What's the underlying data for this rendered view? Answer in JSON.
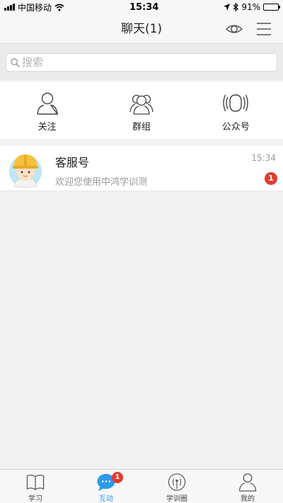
{
  "status_bar": {
    "carrier": "中国移动",
    "time": "15:34",
    "battery": "91%",
    "battery_level": 0.91
  },
  "header": {
    "title": "聊天(1)",
    "eye_icon": "eye-icon",
    "menu_icon": "menu-icon"
  },
  "search": {
    "placeholder": "搜索",
    "value": ""
  },
  "quick_actions": [
    {
      "label": "关注",
      "icon": "person-icon"
    },
    {
      "label": "群组",
      "icon": "group-icon"
    },
    {
      "label": "公众号",
      "icon": "broadcast-icon"
    }
  ],
  "chats": [
    {
      "name": "客服号",
      "message": "欢迎您使用中鸿学训测",
      "time": "15:34",
      "unread": "1",
      "avatar": "worker-helmet-avatar"
    }
  ],
  "tabs": [
    {
      "label": "学习",
      "icon": "book-icon",
      "active": false
    },
    {
      "label": "互动",
      "icon": "chat-bubble-icon",
      "active": true,
      "badge": "1"
    },
    {
      "label": "学训圈",
      "icon": "signal-tower-icon",
      "active": false
    },
    {
      "label": "我的",
      "icon": "user-icon",
      "active": false
    }
  ],
  "colors": {
    "accent": "#2d9cea",
    "badge": "#e43b2f",
    "helmet": "#f6c23e"
  }
}
